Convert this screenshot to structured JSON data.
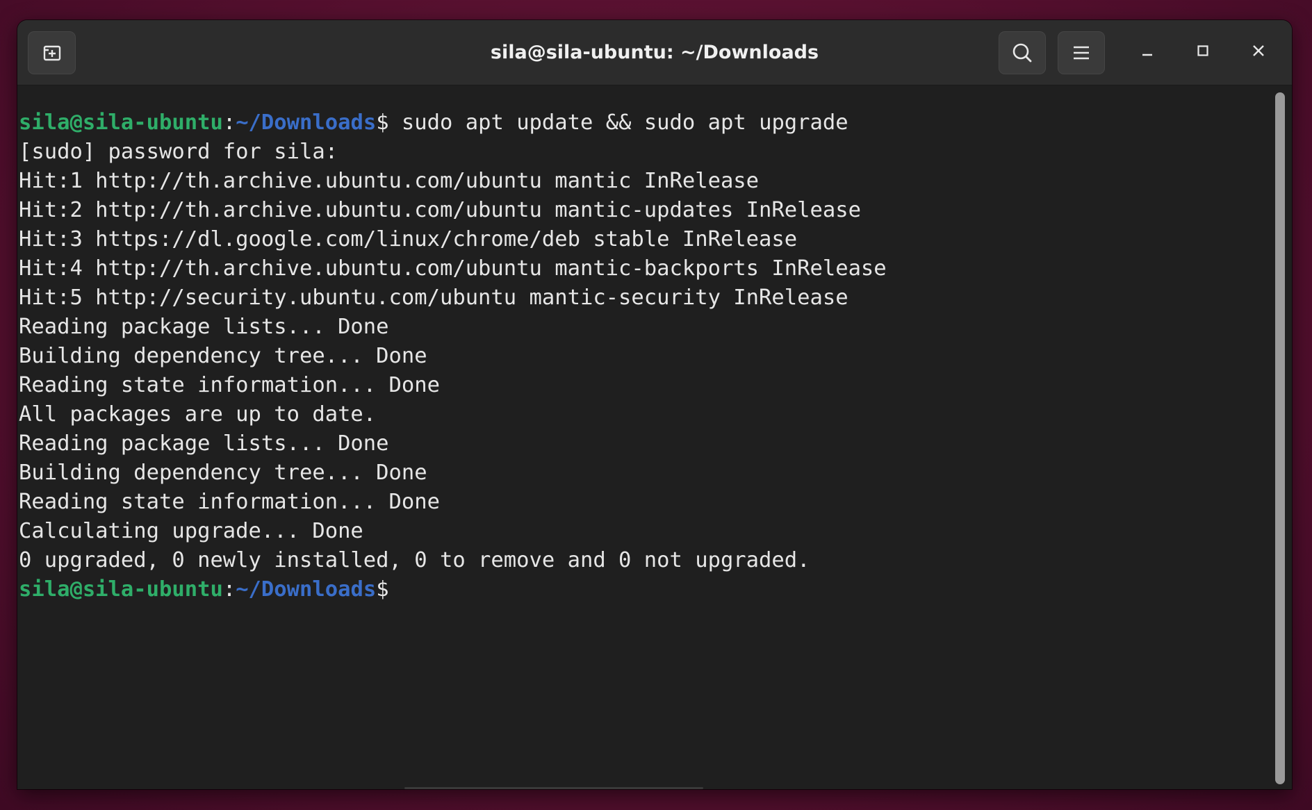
{
  "window": {
    "title": "sila@sila-ubuntu: ~/Downloads"
  },
  "titlebar": {
    "icons": [
      "new-tab-icon",
      "search-icon",
      "hamburger-menu-icon",
      "minimize-icon",
      "maximize-icon",
      "close-icon"
    ]
  },
  "terminal": {
    "prompt": {
      "user_host": "sila@sila-ubuntu",
      "colon": ":",
      "path": "~/Downloads",
      "dollar": "$"
    },
    "command": " sudo apt update && sudo apt upgrade",
    "output": [
      "[sudo] password for sila:",
      "Hit:1 http://th.archive.ubuntu.com/ubuntu mantic InRelease",
      "Hit:2 http://th.archive.ubuntu.com/ubuntu mantic-updates InRelease",
      "Hit:3 https://dl.google.com/linux/chrome/deb stable InRelease",
      "Hit:4 http://th.archive.ubuntu.com/ubuntu mantic-backports InRelease",
      "Hit:5 http://security.ubuntu.com/ubuntu mantic-security InRelease",
      "Reading package lists... Done",
      "Building dependency tree... Done",
      "Reading state information... Done",
      "All packages are up to date.",
      "Reading package lists... Done",
      "Building dependency tree... Done",
      "Reading state information... Done",
      "Calculating upgrade... Done",
      "0 upgraded, 0 newly installed, 0 to remove and 0 not upgraded."
    ]
  },
  "colors": {
    "prompt_user": "#2fae69",
    "prompt_path": "#3a6ec9",
    "text": "#e6e6e6",
    "background": "#1f1f1f",
    "desktop": "#56102f"
  }
}
